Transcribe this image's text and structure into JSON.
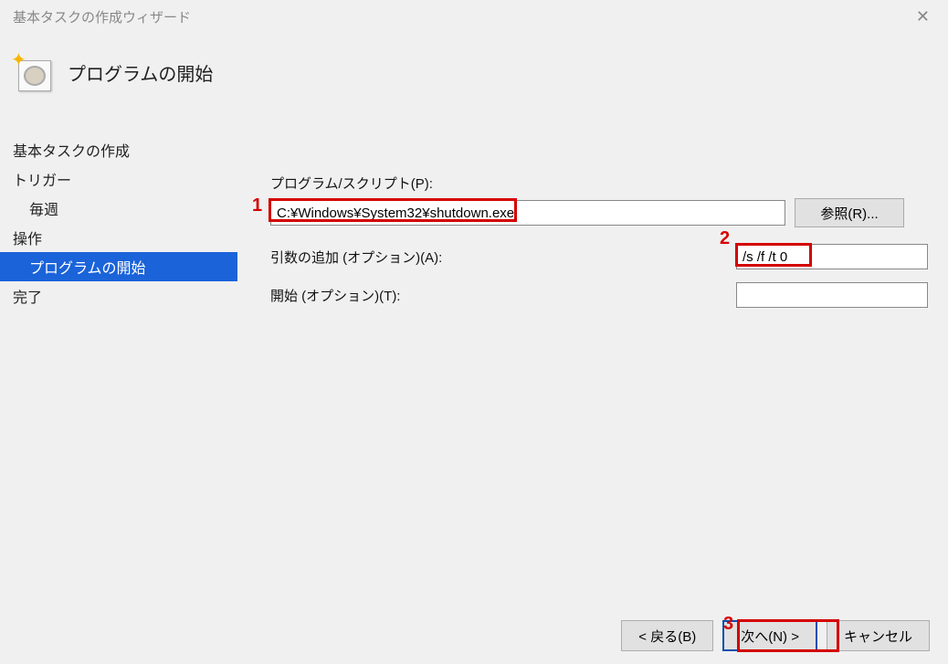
{
  "window": {
    "title": "基本タスクの作成ウィザード"
  },
  "header": {
    "page_title": "プログラムの開始"
  },
  "sidebar": {
    "items": [
      {
        "label": "基本タスクの作成",
        "indent": false,
        "selected": false
      },
      {
        "label": "トリガー",
        "indent": false,
        "selected": false
      },
      {
        "label": "毎週",
        "indent": true,
        "selected": false
      },
      {
        "label": "操作",
        "indent": false,
        "selected": false
      },
      {
        "label": "プログラムの開始",
        "indent": true,
        "selected": true
      },
      {
        "label": "完了",
        "indent": false,
        "selected": false
      }
    ]
  },
  "form": {
    "program_label": "プログラム/スクリプト(P):",
    "program_value": "C:¥Windows¥System32¥shutdown.exe",
    "browse_label": "参照(R)...",
    "args_label": "引数の追加 (オプション)(A):",
    "args_value": "/s /f /t 0",
    "startin_label": "開始 (オプション)(T):",
    "startin_value": ""
  },
  "footer": {
    "back_label": "< 戻る(B)",
    "next_label": "次へ(N) >",
    "cancel_label": "キャンセル"
  },
  "annotations": {
    "m1": "1",
    "m2": "2",
    "m3": "3"
  }
}
